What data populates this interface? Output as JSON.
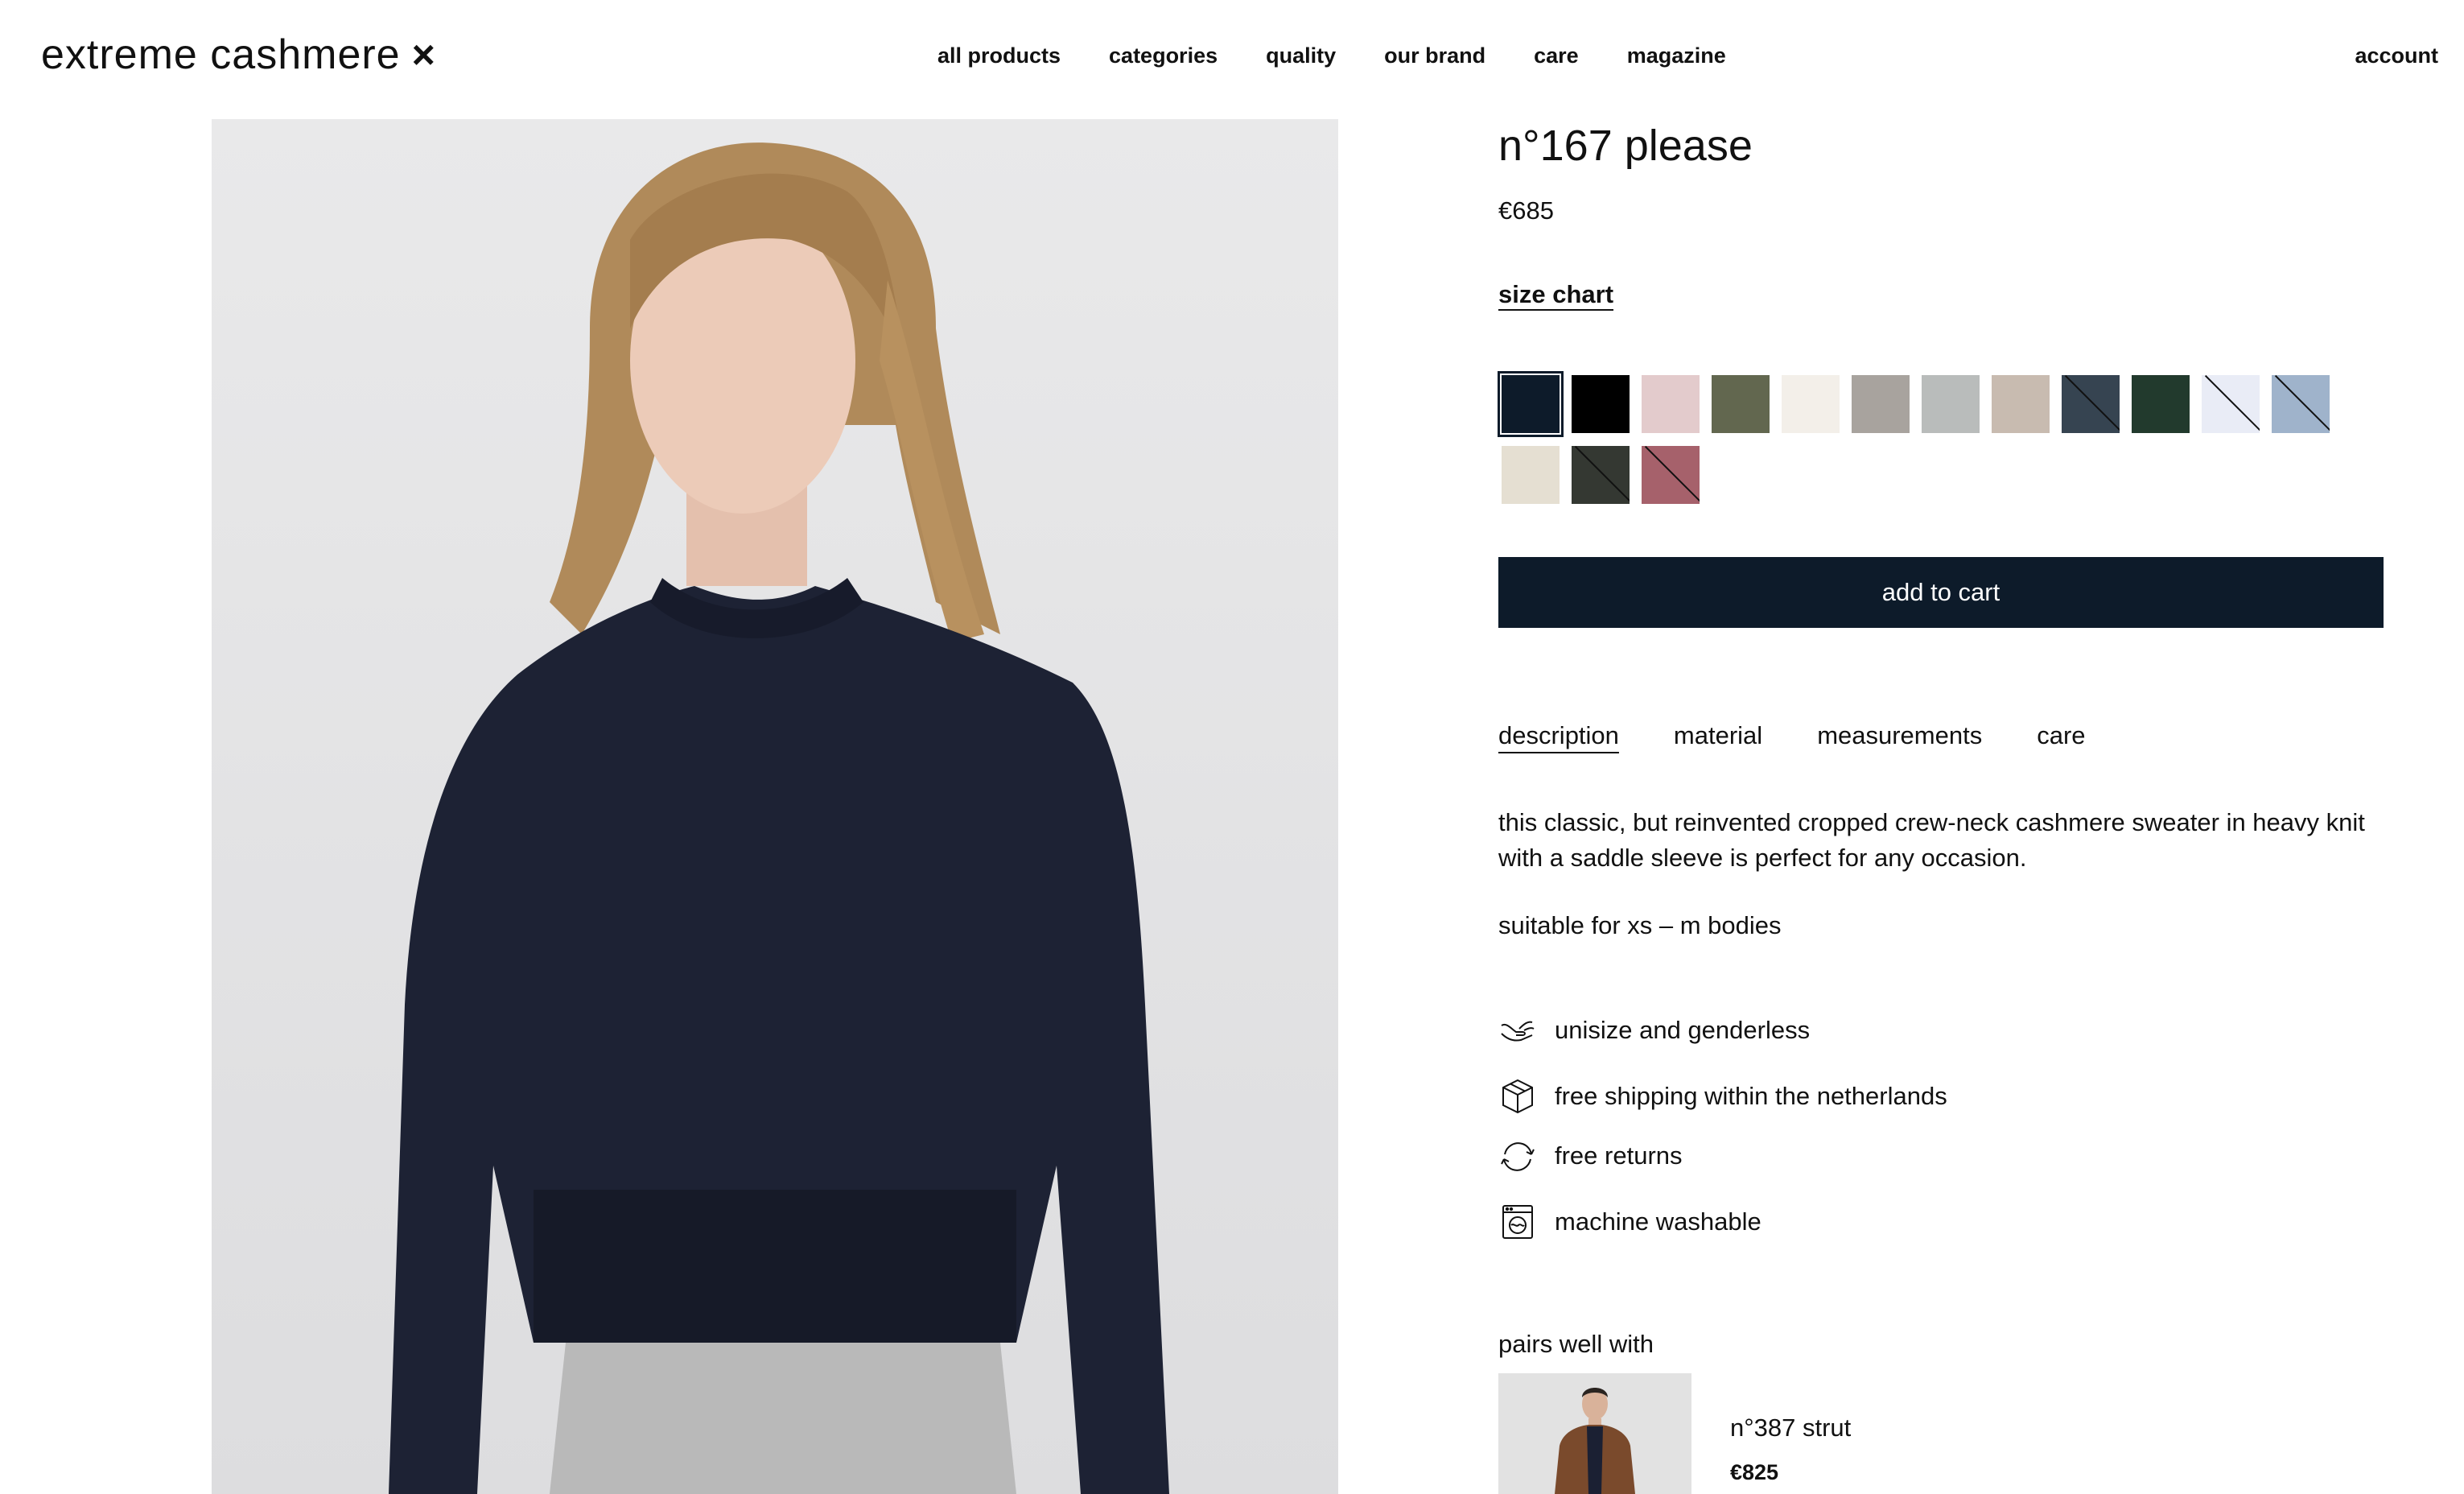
{
  "header": {
    "logo_text": "extreme cashmere",
    "logo_mark": "×",
    "nav": [
      "all products",
      "categories",
      "quality",
      "our brand",
      "care",
      "magazine"
    ],
    "account_label": "account"
  },
  "product": {
    "title": "n°167 please",
    "price": "€685",
    "size_chart_label": "size chart",
    "swatches": [
      {
        "color": "#0d1b2a",
        "selected": true,
        "available": true
      },
      {
        "color": "#000000",
        "selected": false,
        "available": true
      },
      {
        "color": "#e3cbcc",
        "selected": false,
        "available": true
      },
      {
        "color": "#62674f",
        "selected": false,
        "available": true
      },
      {
        "color": "#f3efe9",
        "selected": false,
        "available": true
      },
      {
        "color": "#a8a39e",
        "selected": false,
        "available": true
      },
      {
        "color": "#b9bcbb",
        "selected": false,
        "available": true
      },
      {
        "color": "#c8bbb0",
        "selected": false,
        "available": true
      },
      {
        "color": "#364451",
        "selected": false,
        "available": false
      },
      {
        "color": "#223a2d",
        "selected": false,
        "available": true
      },
      {
        "color": "#e9ecf6",
        "selected": false,
        "available": false
      },
      {
        "color": "#9fb3cb",
        "selected": false,
        "available": false
      },
      {
        "color": "#e5dfd2",
        "selected": false,
        "available": true
      },
      {
        "color": "#343832",
        "selected": false,
        "available": false
      },
      {
        "color": "#a6616b",
        "selected": false,
        "available": false
      }
    ],
    "add_to_cart_label": "add to cart",
    "tabs": [
      {
        "label": "description",
        "active": true
      },
      {
        "label": "material",
        "active": false
      },
      {
        "label": "measurements",
        "active": false
      },
      {
        "label": "care",
        "active": false
      }
    ],
    "description": "this classic, but reinvented cropped crew-neck cashmere sweater in heavy knit with a saddle sleeve is perfect for any occasion.",
    "suitable": "suitable for xs – m bodies",
    "features": [
      {
        "icon": "hands-icon",
        "label": "unisize and genderless"
      },
      {
        "icon": "box-icon",
        "label": "free shipping within the netherlands"
      },
      {
        "icon": "refresh-icon",
        "label": "free returns"
      },
      {
        "icon": "washing-machine-icon",
        "label": "machine washable"
      }
    ]
  },
  "pairs": {
    "title": "pairs well with",
    "item_name": "n°387 strut",
    "item_price": "€825"
  }
}
